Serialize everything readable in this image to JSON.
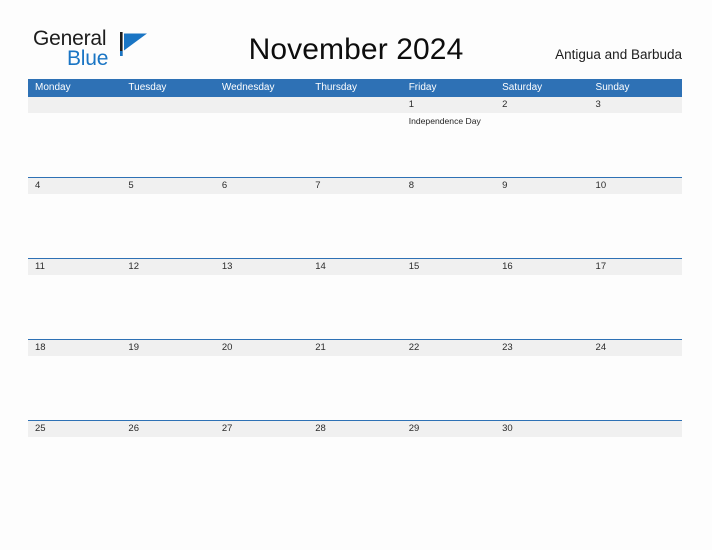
{
  "brand": {
    "name_part1": "General",
    "name_part2": "Blue",
    "flag_icon": "flag-triangle-icon",
    "color_primary": "#1a75c4",
    "color_text": "#1d1d1d"
  },
  "header": {
    "title": "November 2024",
    "region": "Antigua and Barbuda"
  },
  "calendar": {
    "header_bg": "#2e71b5",
    "band_bg": "#f0f0f0",
    "weekdays": [
      "Monday",
      "Tuesday",
      "Wednesday",
      "Thursday",
      "Friday",
      "Saturday",
      "Sunday"
    ],
    "weeks": [
      {
        "days": [
          {
            "date": "",
            "events": []
          },
          {
            "date": "",
            "events": []
          },
          {
            "date": "",
            "events": []
          },
          {
            "date": "",
            "events": []
          },
          {
            "date": "1",
            "events": [
              "Independence Day"
            ]
          },
          {
            "date": "2",
            "events": []
          },
          {
            "date": "3",
            "events": []
          }
        ]
      },
      {
        "days": [
          {
            "date": "4",
            "events": []
          },
          {
            "date": "5",
            "events": []
          },
          {
            "date": "6",
            "events": []
          },
          {
            "date": "7",
            "events": []
          },
          {
            "date": "8",
            "events": []
          },
          {
            "date": "9",
            "events": []
          },
          {
            "date": "10",
            "events": []
          }
        ]
      },
      {
        "days": [
          {
            "date": "11",
            "events": []
          },
          {
            "date": "12",
            "events": []
          },
          {
            "date": "13",
            "events": []
          },
          {
            "date": "14",
            "events": []
          },
          {
            "date": "15",
            "events": []
          },
          {
            "date": "16",
            "events": []
          },
          {
            "date": "17",
            "events": []
          }
        ]
      },
      {
        "days": [
          {
            "date": "18",
            "events": []
          },
          {
            "date": "19",
            "events": []
          },
          {
            "date": "20",
            "events": []
          },
          {
            "date": "21",
            "events": []
          },
          {
            "date": "22",
            "events": []
          },
          {
            "date": "23",
            "events": []
          },
          {
            "date": "24",
            "events": []
          }
        ]
      },
      {
        "days": [
          {
            "date": "25",
            "events": []
          },
          {
            "date": "26",
            "events": []
          },
          {
            "date": "27",
            "events": []
          },
          {
            "date": "28",
            "events": []
          },
          {
            "date": "29",
            "events": []
          },
          {
            "date": "30",
            "events": []
          },
          {
            "date": "",
            "events": []
          }
        ]
      }
    ]
  }
}
